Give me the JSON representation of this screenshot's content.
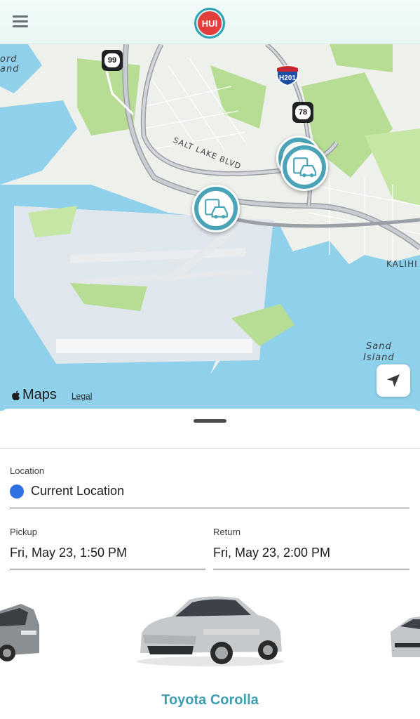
{
  "header": {
    "logo_text": "HUI",
    "menu_icon": "hamburger-menu-icon"
  },
  "map": {
    "labels": {
      "street_salt_lake": "SALT LAKE BLVD",
      "district_kalihi": "KALIHI",
      "island_sand": "Sand\nIsland",
      "partial_ford_island": "ord\nand"
    },
    "highway_shields": {
      "h99": "99",
      "h78": "78",
      "interstate": "H201"
    },
    "brand": "Maps",
    "legal_link": "Legal",
    "colors": {
      "water": "#8fd0ea",
      "land": "#eef0ec",
      "park": "#b7dd95",
      "road": "#b8b8b8",
      "station": "#4aa3b6"
    }
  },
  "form": {
    "location_label": "Location",
    "location_value": "Current Location",
    "pickup_label": "Pickup",
    "pickup_value": "Fri, May 23, 1:50 PM",
    "return_label": "Return",
    "return_value": "Fri, May 23, 2:00 PM"
  },
  "vehicles": {
    "selected_name": "Toyota Corolla",
    "selected_color": "#3e9eb2"
  }
}
